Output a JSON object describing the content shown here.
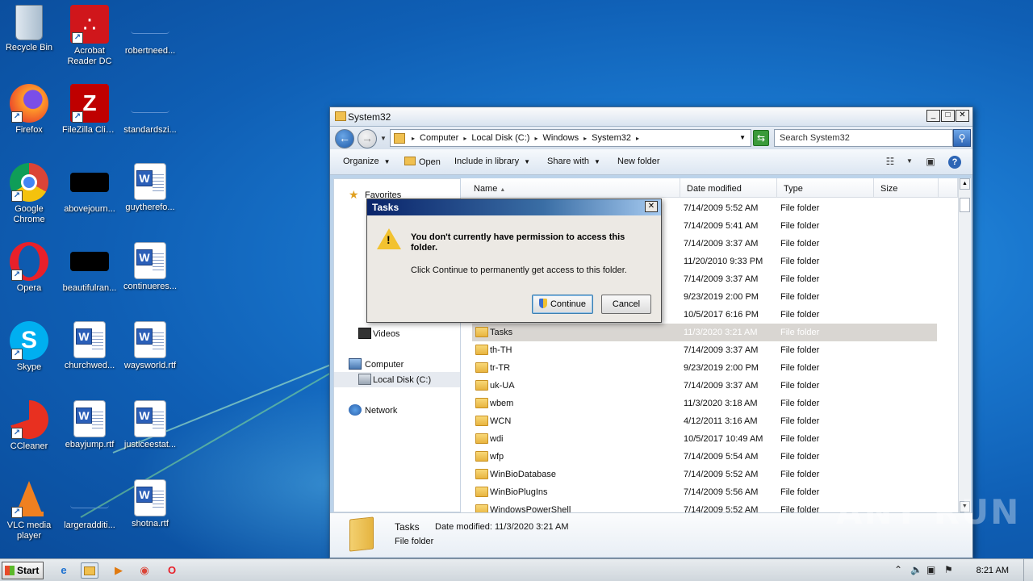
{
  "desktop": {
    "icons": [
      {
        "label": "Recycle Bin"
      },
      {
        "label": "Acrobat Reader DC"
      },
      {
        "label": "robertneed..."
      },
      {
        "label": "Firefox"
      },
      {
        "label": "FileZilla Client"
      },
      {
        "label": "standardszi..."
      },
      {
        "label": "Google Chrome"
      },
      {
        "label": "abovejourn..."
      },
      {
        "label": "guytherefo..."
      },
      {
        "label": "Opera"
      },
      {
        "label": "beautifulran..."
      },
      {
        "label": "continueres..."
      },
      {
        "label": "Skype"
      },
      {
        "label": "churchwed..."
      },
      {
        "label": "waysworld.rtf"
      },
      {
        "label": "CCleaner"
      },
      {
        "label": "ebayjump.rtf"
      },
      {
        "label": "justiceestat..."
      },
      {
        "label": "VLC media player"
      },
      {
        "label": "largeradditi..."
      },
      {
        "label": "shotna.rtf"
      }
    ],
    "watermark": "ANY RUN"
  },
  "explorer": {
    "title": "System32",
    "breadcrumbs": [
      "Computer",
      "Local Disk (C:)",
      "Windows",
      "System32"
    ],
    "search_placeholder": "Search System32",
    "toolbar": {
      "organize": "Organize",
      "open": "Open",
      "include_in_library": "Include in library",
      "share_with": "Share with",
      "new_folder": "New folder"
    },
    "nav": {
      "favorites": "Favorites",
      "videos": "Videos",
      "computer": "Computer",
      "local_disk": "Local Disk (C:)",
      "network": "Network"
    },
    "columns": [
      "Name",
      "Date modified",
      "Type",
      "Size"
    ],
    "rows": [
      {
        "name": "",
        "date": "7/14/2009 5:52 AM",
        "type": "File folder"
      },
      {
        "name": "",
        "date": "7/14/2009 5:41 AM",
        "type": "File folder"
      },
      {
        "name": "",
        "date": "7/14/2009 3:37 AM",
        "type": "File folder"
      },
      {
        "name": "",
        "date": "11/20/2010 9:33 PM",
        "type": "File folder"
      },
      {
        "name": "",
        "date": "7/14/2009 3:37 AM",
        "type": "File folder"
      },
      {
        "name": "",
        "date": "9/23/2019 2:00 PM",
        "type": "File folder"
      },
      {
        "name": "",
        "date": "10/5/2017 6:16 PM",
        "type": "File folder"
      },
      {
        "name": "Tasks",
        "date": "11/3/2020 3:21 AM",
        "type": "File folder"
      },
      {
        "name": "th-TH",
        "date": "7/14/2009 3:37 AM",
        "type": "File folder"
      },
      {
        "name": "tr-TR",
        "date": "9/23/2019 2:00 PM",
        "type": "File folder"
      },
      {
        "name": "uk-UA",
        "date": "7/14/2009 3:37 AM",
        "type": "File folder"
      },
      {
        "name": "wbem",
        "date": "11/3/2020 3:18 AM",
        "type": "File folder"
      },
      {
        "name": "WCN",
        "date": "4/12/2011 3:16 AM",
        "type": "File folder"
      },
      {
        "name": "wdi",
        "date": "10/5/2017 10:49 AM",
        "type": "File folder"
      },
      {
        "name": "wfp",
        "date": "7/14/2009 5:54 AM",
        "type": "File folder"
      },
      {
        "name": "WinBioDatabase",
        "date": "7/14/2009 5:52 AM",
        "type": "File folder"
      },
      {
        "name": "WinBioPlugIns",
        "date": "7/14/2009 5:56 AM",
        "type": "File folder"
      },
      {
        "name": "WindowsPowerShell",
        "date": "7/14/2009 5:52 AM",
        "type": "File folder"
      }
    ],
    "details": {
      "name": "Tasks",
      "date_modified": "Date modified:  11/3/2020 3:21 AM",
      "type": "File folder"
    }
  },
  "dialog": {
    "title": "Tasks",
    "message": "You don't currently have permission to access this folder.",
    "sub": "Click Continue to permanently get access to this folder.",
    "continue": "Continue",
    "cancel": "Cancel"
  },
  "taskbar": {
    "start": "Start",
    "clock": "8:21 AM"
  }
}
